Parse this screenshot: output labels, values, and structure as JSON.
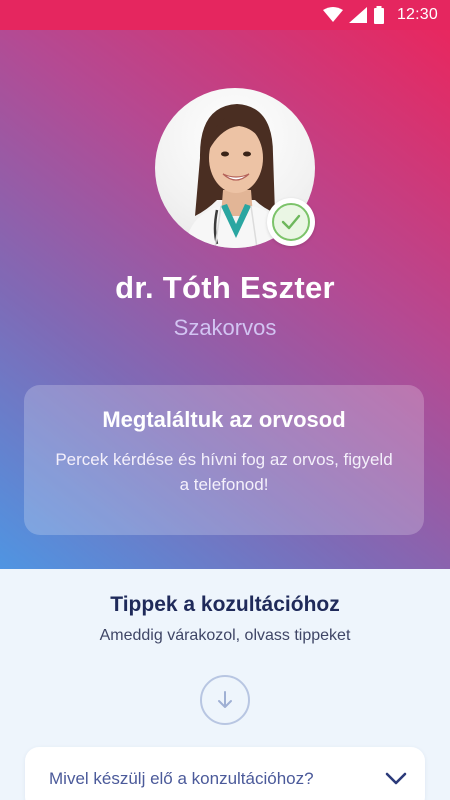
{
  "status_bar": {
    "time": "12:30",
    "icons": [
      "wifi-icon",
      "signal-icon",
      "battery-icon"
    ]
  },
  "doctor": {
    "name": "dr. Tóth Eszter",
    "title": "Szakorvos",
    "avatar": "doctor-photo",
    "verified_icon": "check-icon"
  },
  "found_card": {
    "title": "Megtaláltuk az orvosod",
    "text": "Percek kérdése és hívni fog az orvos, figyeld a telefonod!"
  },
  "tips": {
    "title": "Tippek a kozultációhoz",
    "subtitle": "Ameddig várakozol, olvass tippeket",
    "scroll_icon": "arrow-down-icon",
    "faq_question": "Mivel készülj elő a konzultációhoz?",
    "faq_icon": "chevron-down-icon"
  },
  "colors": {
    "status_bar": "#e5265f",
    "gradient_start": "#e8275f",
    "gradient_end": "#4f95e2",
    "verified_green": "#7cc36a",
    "tips_title": "#1f2a5a",
    "faq_text": "#4b5a9a",
    "section_bg": "#eef5fc"
  }
}
